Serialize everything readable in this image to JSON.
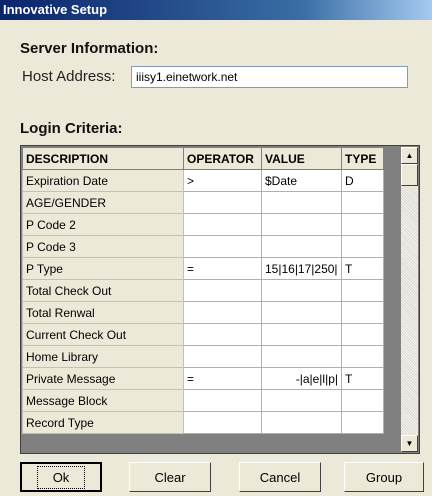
{
  "window": {
    "title": "Innovative Setup"
  },
  "server": {
    "heading": "Server Information:",
    "host_label": "Host Address:",
    "host_value": "iiisy1.einetwork.net"
  },
  "login": {
    "heading": "Login Criteria:",
    "columns": [
      "DESCRIPTION",
      "OPERATOR",
      "VALUE",
      "TYPE"
    ],
    "rows": [
      {
        "description": "Expiration Date",
        "operator": ">",
        "value": "$Date",
        "type": "D"
      },
      {
        "description": "AGE/GENDER",
        "operator": "",
        "value": "",
        "type": ""
      },
      {
        "description": "P Code 2",
        "operator": "",
        "value": "",
        "type": ""
      },
      {
        "description": "P Code 3",
        "operator": "",
        "value": "",
        "type": ""
      },
      {
        "description": "P Type",
        "operator": "=",
        "value": "15|16|17|250|",
        "type": "T"
      },
      {
        "description": "Total Check Out",
        "operator": "",
        "value": "",
        "type": ""
      },
      {
        "description": "Total Renwal",
        "operator": "",
        "value": "",
        "type": ""
      },
      {
        "description": "Current Check Out",
        "operator": "",
        "value": "",
        "type": ""
      },
      {
        "description": "Home Library",
        "operator": "",
        "value": "",
        "type": ""
      },
      {
        "description": "Private Message",
        "operator": "=",
        "value": "-|a|e|l|p|",
        "type": "T"
      },
      {
        "description": "Message Block",
        "operator": "",
        "value": "",
        "type": ""
      },
      {
        "description": "Record Type",
        "operator": "",
        "value": "",
        "type": ""
      }
    ]
  },
  "buttons": {
    "ok": "Ok",
    "clear": "Clear",
    "cancel": "Cancel",
    "group": "Group"
  },
  "icons": {
    "scroll_up": "scroll-up-arrow-icon",
    "scroll_down": "scroll-down-arrow-icon"
  }
}
